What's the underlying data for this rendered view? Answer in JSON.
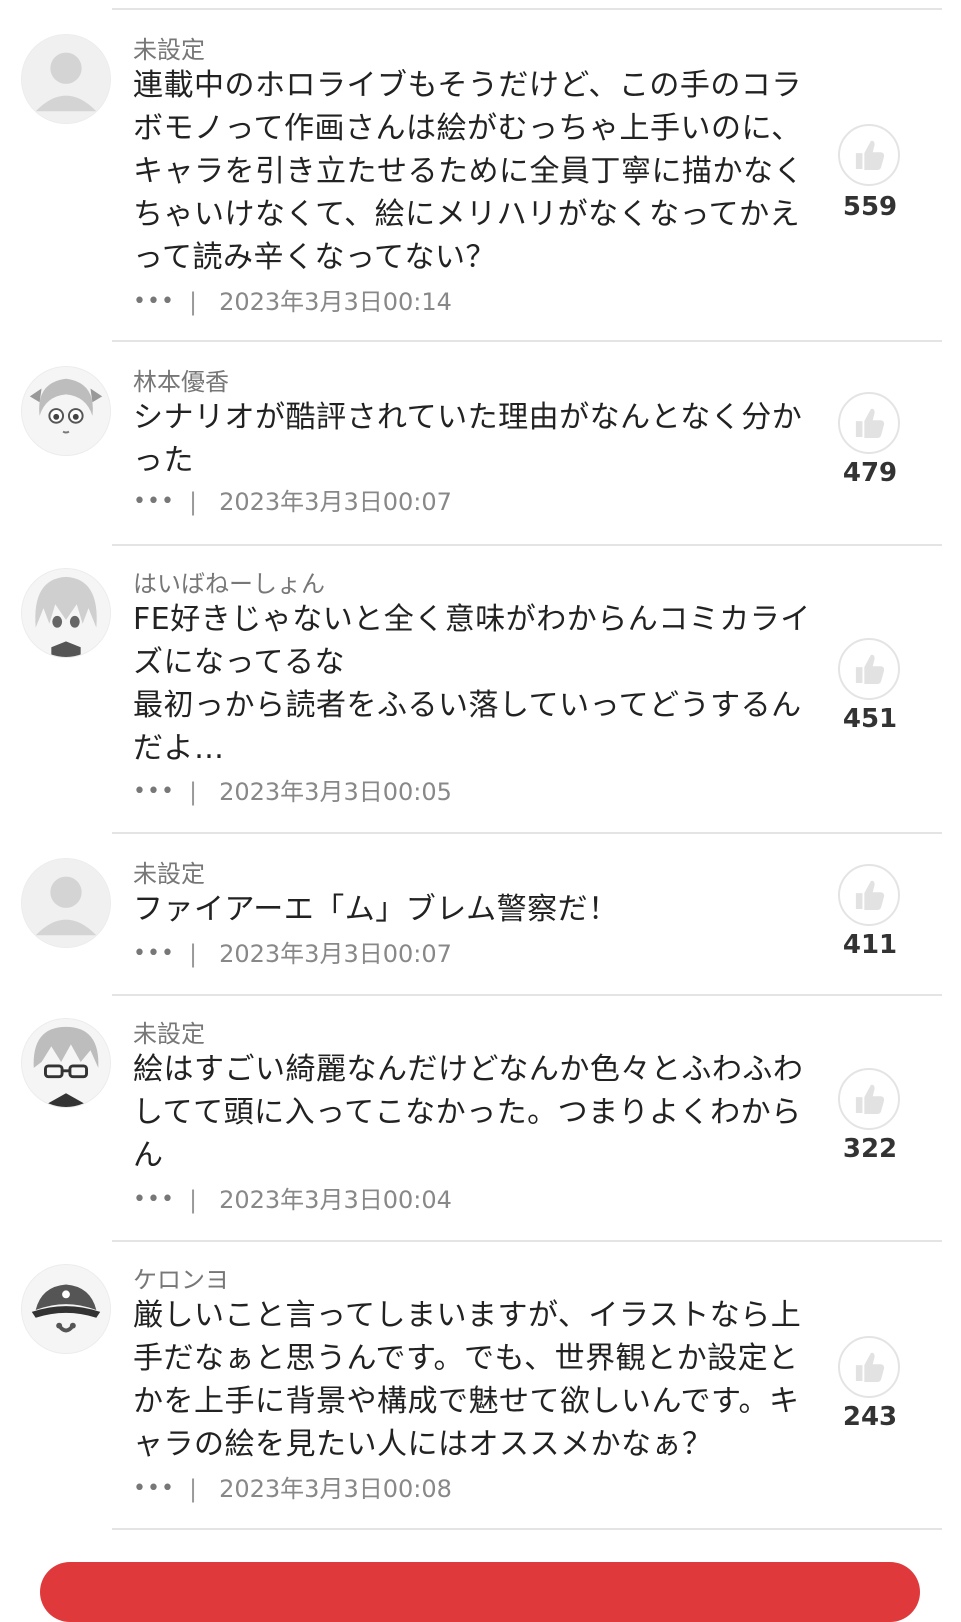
{
  "comments": [
    {
      "username": "未設定",
      "text": "連載中のホロライブもそうだけど、この手のコラ\nボモノって作画さんは絵がむっちゃ上手いのに、\nキャラを引き立たせるために全員丁寧に描かなく\nちゃいけなくて、絵にメリハリがなくなってかえ\nって読み辛くなってない？",
      "more": "•••",
      "separator": "|",
      "timestamp": "2023年3月3日00:14",
      "likes": "559",
      "avatar": "default-avatar-icon"
    },
    {
      "username": "林本優香",
      "text": "シナリオが酷評されていた理由がなんとなく分か\nった",
      "more": "•••",
      "separator": "|",
      "timestamp": "2023年3月3日00:07",
      "likes": "479",
      "avatar": "manga-girl-avatar"
    },
    {
      "username": "はいばねーしょん",
      "text": "FE好きじゃないと全く意味がわからんコミカライ\nズになってるな\n最初っから読者をふるい落していってどうするん\nだよ…",
      "more": "•••",
      "separator": "|",
      "timestamp": "2023年3月3日00:05",
      "likes": "451",
      "avatar": "manga-character-avatar"
    },
    {
      "username": "未設定",
      "text": "ファイアーエ「ム」ブレム警察だ！",
      "more": "•••",
      "separator": "|",
      "timestamp": "2023年3月3日00:07",
      "likes": "411",
      "avatar": "default-avatar-icon"
    },
    {
      "username": "未設定",
      "text": "絵はすごい綺麗なんだけどなんか色々とふわふわ\nしてて頭に入ってこなかった。つまりよくわから\nん",
      "more": "•••",
      "separator": "|",
      "timestamp": "2023年3月3日00:04",
      "likes": "322",
      "avatar": "manga-glasses-avatar"
    },
    {
      "username": "ケロンヨ",
      "text": "厳しいこと言ってしまいますが、イラストなら上\n手だなぁと思うんです。でも、世界観とか設定と\nかを上手に背景や構成で魅せて欲しいんです。キ\nャラの絵を見たい人にはオススメかなぁ？",
      "more": "•••",
      "separator": "|",
      "timestamp": "2023年3月3日00:08",
      "likes": "243",
      "avatar": "pirate-hat-avatar"
    }
  ],
  "colors": {
    "accent": "#e0393c",
    "divider": "#e4e4e4",
    "muted_text": "#777777"
  }
}
